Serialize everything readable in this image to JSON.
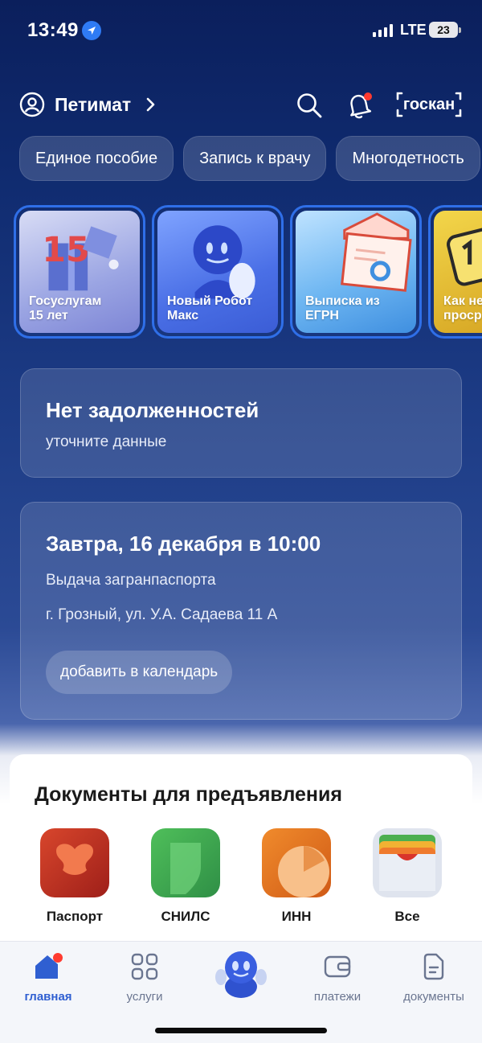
{
  "status_bar": {
    "time": "13:49",
    "network": "LTE",
    "battery": "23"
  },
  "header": {
    "user_name": "Петимат",
    "scan_label": "госкан"
  },
  "chips": [
    "Единое пособие",
    "Запись к врачу",
    "Многодетность"
  ],
  "stories": [
    {
      "title": "Госуслугам 15 лет"
    },
    {
      "title": "Новый Робот Макс"
    },
    {
      "title": "Выписка из ЕГРН"
    },
    {
      "title": "Как не просрочить"
    }
  ],
  "debt_card": {
    "title": "Нет задолженностей",
    "subtitle": "уточните данные"
  },
  "appointment": {
    "title": "Завтра, 16 декабря в 10:00",
    "service": "Выдача загранпаспорта",
    "address": "г. Грозный, ул. У.А. Садаева 11 А",
    "button": "добавить в календарь"
  },
  "documents": {
    "title": "Документы для предъявления",
    "items": [
      {
        "label": "Паспорт"
      },
      {
        "label": "СНИЛС"
      },
      {
        "label": "ИНН"
      },
      {
        "label": "Все"
      }
    ]
  },
  "nav": {
    "home": "главная",
    "services": "услуги",
    "payments": "платежи",
    "documents": "документы"
  },
  "colors": {
    "accent": "#2f5fd1",
    "background_top": "#0b1f5c",
    "notification": "#ff3b30"
  }
}
